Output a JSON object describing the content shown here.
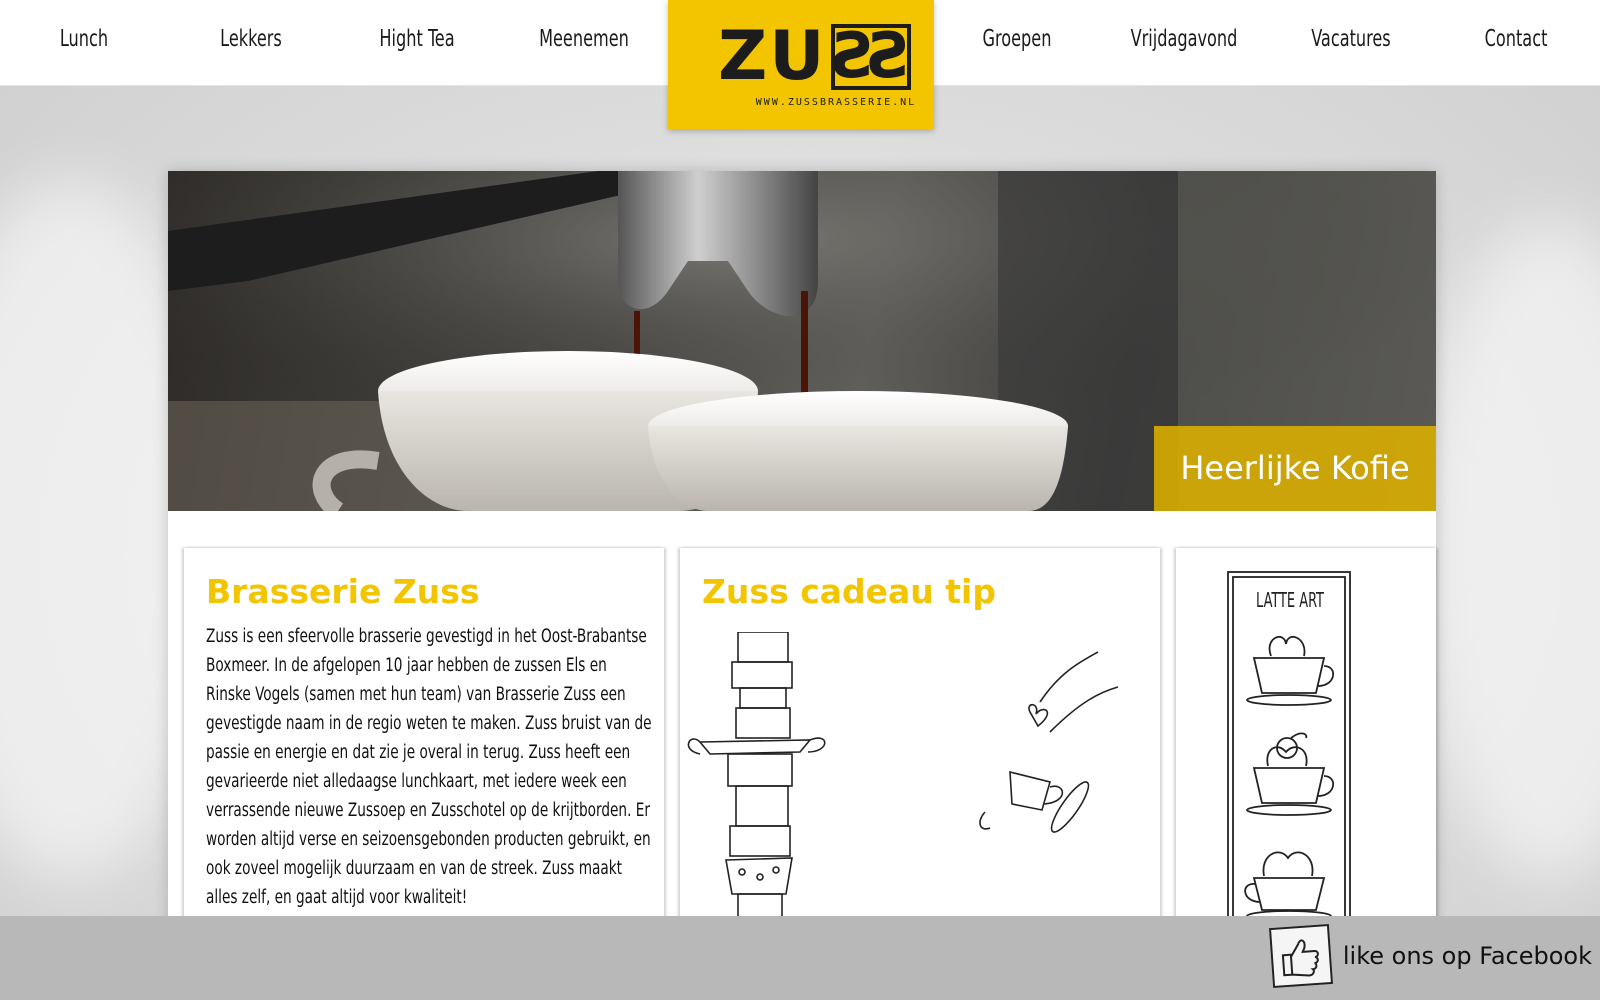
{
  "nav": {
    "left": [
      "Lunch",
      "Lekkers",
      "Hight Tea",
      "Meenemen"
    ],
    "right": [
      "Groepen",
      "Vrijdagavond",
      "Vacatures",
      "Contact"
    ]
  },
  "logo": {
    "text_main": "ZU",
    "text_mirror": "SS",
    "url": "WWW.ZUSSBRASSERIE.NL"
  },
  "hero": {
    "caption": "Heerlijke Kofie"
  },
  "cards": {
    "about": {
      "title": "Brasserie Zuss",
      "lines": [
        "Zuss is een sfeervolle brasserie gevestigd in het Oost-Brabantse",
        "Boxmeer. In de afgelopen 10 jaar hebben de zussen Els en",
        "Rinske Vogels (samen met hun team) van Brasserie Zuss een",
        "gevestigde naam in de regio weten te maken. Zuss bruist van de",
        "passie en energie en dat zie je overal in terug. Zuss heeft een",
        "gevarieerde niet alledaagse lunchkaart, met iedere week een",
        "verrassende nieuwe Zussoep en Zusschotel op de krijtborden. Er",
        "worden altijd verse en seizoensgebonden producten gebruikt, en",
        "ook zoveel mogelijk duurzaam en van de streek. Zuss maakt",
        "alles zelf, en gaat altijd voor kwaliteit!"
      ]
    },
    "gift": {
      "title": "Zuss cadeau tip"
    },
    "latte": {
      "label": "LATTE ART"
    }
  },
  "footer": {
    "facebook_label": "like ons op Facebook"
  },
  "colors": {
    "accent_yellow": "#f2c500",
    "footer_gray": "#b8b8b8"
  }
}
